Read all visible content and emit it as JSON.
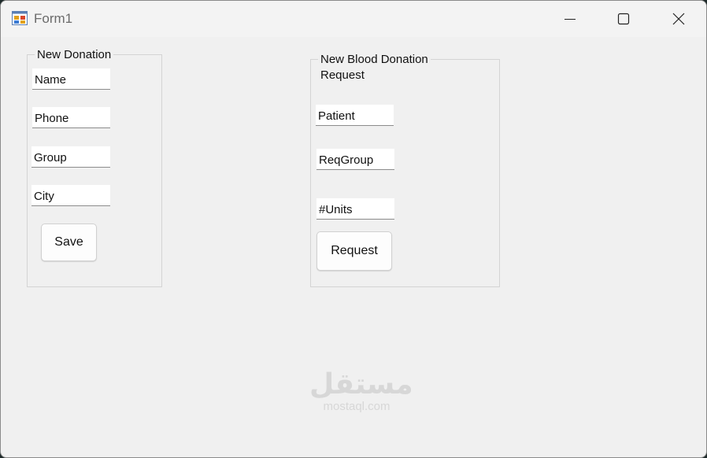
{
  "window": {
    "title": "Form1",
    "icon": "winforms-app-icon",
    "controls": [
      "minimize-icon",
      "maximize-icon",
      "close-icon"
    ]
  },
  "new_donation": {
    "title": "New Donation",
    "fields": {
      "name": "Name",
      "phone": "Phone",
      "group": "Group",
      "city": "City"
    },
    "save_label": "Save"
  },
  "blood_request": {
    "title_line1": "New Blood Donation",
    "title_line2": "Request",
    "fields": {
      "patient": "Patient",
      "req_group": "ReqGroup",
      "units": "#Units"
    },
    "request_label": "Request"
  },
  "watermark": {
    "arabic": "مستقل",
    "latin": "mostaql.com"
  },
  "colors": {
    "window_bg": "#f0f0f0",
    "titlebar_bg": "#f3f3f3",
    "group_border": "#d4d4d4"
  }
}
